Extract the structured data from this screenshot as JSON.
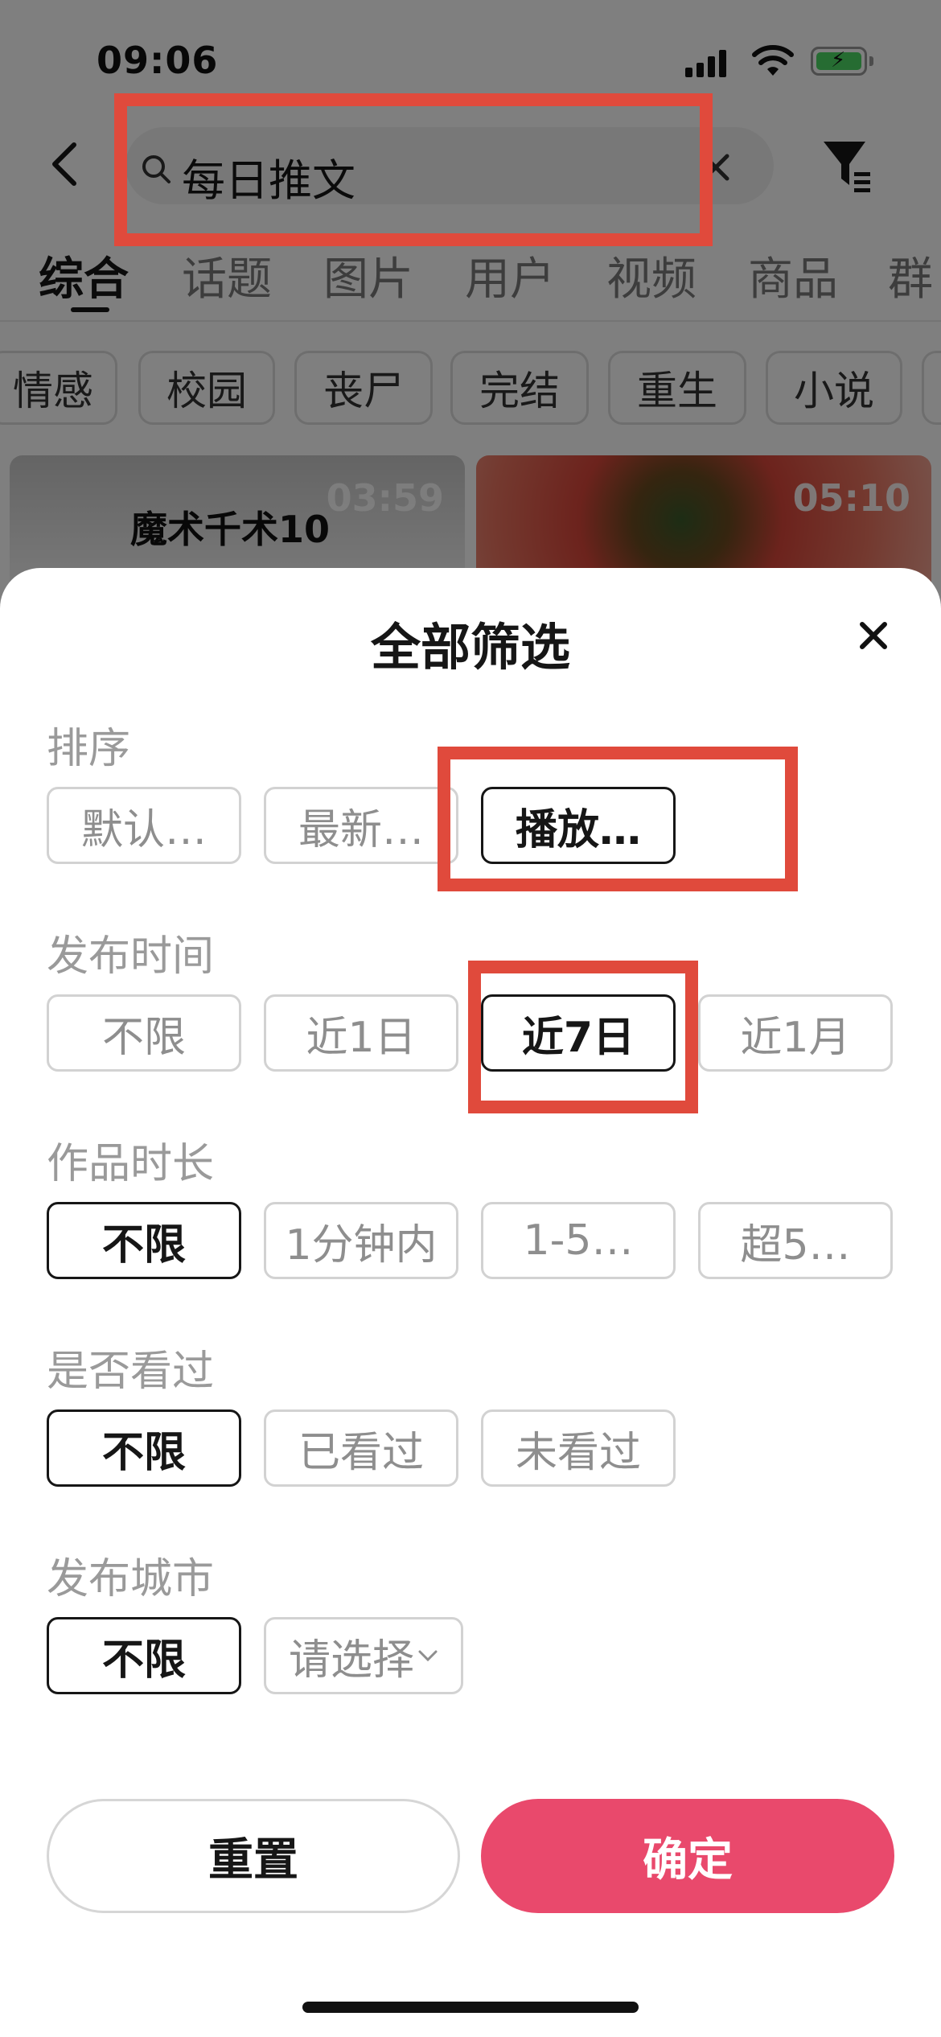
{
  "status_bar": {
    "time": "09:06"
  },
  "search": {
    "query": "每日推文"
  },
  "tabs": [
    "综合",
    "话题",
    "图片",
    "用户",
    "视频",
    "商品",
    "群"
  ],
  "tags": [
    "情感",
    "校园",
    "丧尸",
    "完结",
    "重生",
    "小说"
  ],
  "results": [
    {
      "caption": "魔术千术10",
      "duration": "03:59"
    },
    {
      "caption": "",
      "duration": "05:10"
    }
  ],
  "sheet": {
    "title": "全部筛选",
    "sections": [
      {
        "label": "排序",
        "options": [
          "默认…",
          "最新…",
          "播放…"
        ],
        "selected": 2
      },
      {
        "label": "发布时间",
        "options": [
          "不限",
          "近1日",
          "近7日",
          "近1月"
        ],
        "selected": 2
      },
      {
        "label": "作品时长",
        "options": [
          "不限",
          "1分钟内",
          "1-5…",
          "超5…"
        ],
        "selected": 0
      },
      {
        "label": "是否看过",
        "options": [
          "不限",
          "已看过",
          "未看过"
        ],
        "selected": 0
      },
      {
        "label": "发布城市",
        "options": [
          "不限",
          "请选择"
        ],
        "selected": 0
      }
    ],
    "reset_label": "重置",
    "confirm_label": "确定"
  },
  "colors": {
    "accent": "#e9496c",
    "highlight": "#e04a3c",
    "battery": "#4cd964"
  },
  "icons": [
    "back-arrow-icon",
    "search-icon",
    "clear-icon",
    "filter-icon",
    "close-icon",
    "chevron-down-icon"
  ]
}
